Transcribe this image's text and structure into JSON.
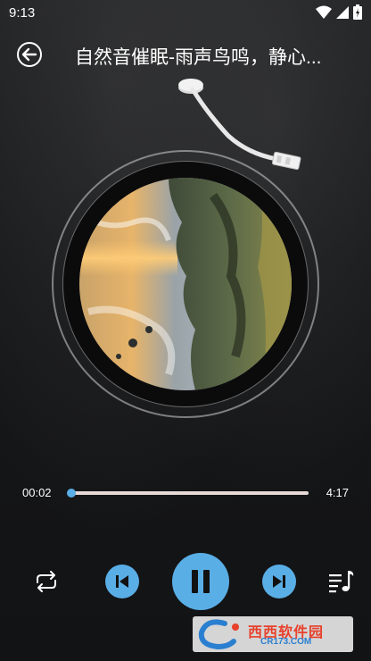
{
  "status_bar": {
    "time": "9:13",
    "icons": [
      "wifi-icon",
      "signal-icon",
      "battery-icon"
    ]
  },
  "header": {
    "back_icon": "arrow-left-circle-icon",
    "title": "自然音催眠-雨声鸟鸣，静心..."
  },
  "player": {
    "elapsed": "00:02",
    "total": "4:17",
    "progress_fraction": 0.008
  },
  "controls": {
    "repeat_icon": "repeat-icon",
    "prev_icon": "skip-previous-icon",
    "play_pause_icon": "pause-icon",
    "next_icon": "skip-next-icon",
    "playlist_icon": "playlist-music-icon"
  },
  "watermark": {
    "main": "西西软件园",
    "sub": "CR173.COM"
  },
  "colors": {
    "accent": "#5aaee6",
    "track": "#e6d9d6",
    "background": "#141517"
  }
}
